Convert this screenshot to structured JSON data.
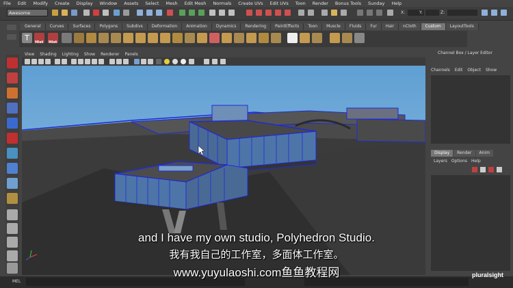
{
  "menubar": {
    "items": [
      "File",
      "Edit",
      "Modify",
      "Create",
      "Display",
      "Window",
      "Assets",
      "Select",
      "Mesh",
      "Edit Mesh",
      "Normals",
      "Create UVs",
      "Edit UVs",
      "Toon",
      "Render",
      "Bonus Tools",
      "Sunday",
      "Help"
    ]
  },
  "statusline": {
    "mode": "Awesome",
    "coord_labels": [
      "X:",
      "Y:",
      "Z:"
    ]
  },
  "shelf": {
    "tabs": [
      "General",
      "Curves",
      "Surfaces",
      "Polygons",
      "Subdivs",
      "Deformation",
      "Animation",
      "Dynamics",
      "Rendering",
      "PaintEffects",
      "Toon",
      "Muscle",
      "Fluids",
      "Fur",
      "Hair",
      "nCloth",
      "Custom",
      "LayoutTools"
    ],
    "active_tab": "Custom",
    "hist_labels": [
      "Hist",
      "Hist"
    ]
  },
  "viewport": {
    "menu": [
      "View",
      "Shading",
      "Lighting",
      "Show",
      "Renderer",
      "Panels"
    ]
  },
  "channel_box": {
    "title": "Channel Box / Layer Editor",
    "menu": [
      "Channels",
      "Edit",
      "Object",
      "Show"
    ]
  },
  "layer_editor": {
    "tabs": [
      "Display",
      "Render",
      "Anim"
    ],
    "active_tab": "Display",
    "menu": [
      "Layers",
      "Options",
      "Help"
    ]
  },
  "command_line": {
    "label": "MEL"
  },
  "subtitles": {
    "english": "and I have my own studio, Polyhedron Studio.",
    "chinese": "我有我自己的工作室，多面体工作室。",
    "watermark": "www.yuyulaoshi.com鱼鱼教程网"
  },
  "brand": {
    "name": "pluralsight"
  },
  "colors": {
    "sky": "#6aa9d8",
    "ground": "#3f3f3f",
    "glass": "#4a6fa0",
    "wireframe": "#1f2bd6",
    "accent": "#f15b2a"
  }
}
